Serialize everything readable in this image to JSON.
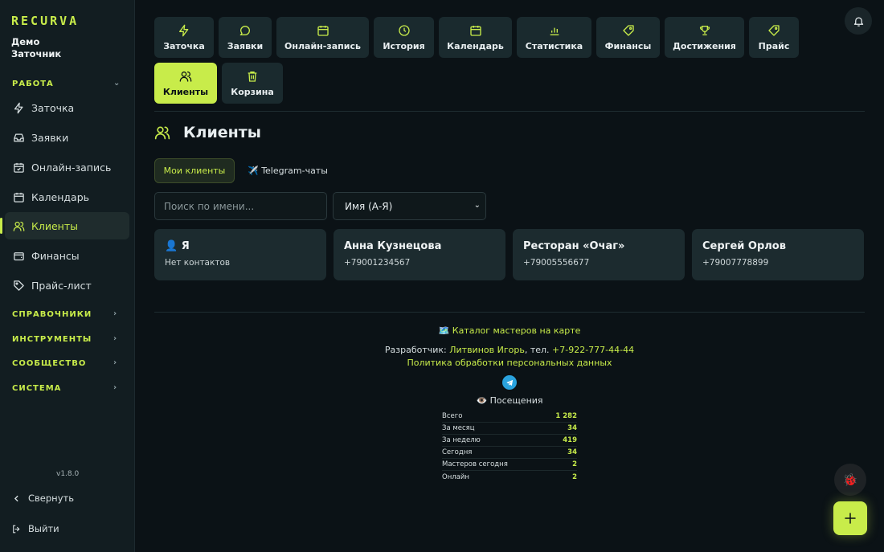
{
  "app": {
    "logo": "RECURVA",
    "user_line1": "Демо",
    "user_line2": "Заточник",
    "version": "v1.8.0"
  },
  "sidebar": {
    "section_work": "РАБОТА",
    "items": [
      {
        "label": "Заточка"
      },
      {
        "label": "Заявки"
      },
      {
        "label": "Онлайн-запись"
      },
      {
        "label": "Календарь"
      },
      {
        "label": "Клиенты",
        "active": true
      },
      {
        "label": "Финансы"
      },
      {
        "label": "Прайс-лист"
      }
    ],
    "sections": [
      "СПРАВОЧНИКИ",
      "ИНСТРУМЕНТЫ",
      "СООБЩЕСТВО",
      "СИСТЕМА"
    ],
    "collapse_label": "Свернуть",
    "logout_label": "Выйти"
  },
  "tiles": [
    {
      "label": "Заточка",
      "icon": "lightning-icon"
    },
    {
      "label": "Заявки",
      "icon": "chat-bubble-icon"
    },
    {
      "label": "Онлайн-запись",
      "icon": "calendar-check-icon"
    },
    {
      "label": "История",
      "icon": "clock-icon"
    },
    {
      "label": "Календарь",
      "icon": "calendar-icon"
    },
    {
      "label": "Статистика",
      "icon": "bar-chart-icon"
    },
    {
      "label": "Финансы",
      "icon": "tag-icon"
    },
    {
      "label": "Достижения",
      "icon": "trophy-icon"
    },
    {
      "label": "Прайс",
      "icon": "price-tag-icon"
    },
    {
      "label": "Клиенты",
      "icon": "users-icon",
      "active": true
    },
    {
      "label": "Корзина",
      "icon": "trash-icon"
    }
  ],
  "page": {
    "title": "Клиенты",
    "tabs": [
      {
        "label": "Мои клиенты",
        "active": true
      },
      {
        "label": "✈️ Telegram-чаты"
      }
    ],
    "search_placeholder": "Поиск по имени...",
    "sort_value": "Имя (А-Я)"
  },
  "clients": [
    {
      "name": "👤 Я",
      "phone": "Нет контактов"
    },
    {
      "name": "Анна Кузнецова",
      "phone": "+79001234567"
    },
    {
      "name": "Ресторан «Очаг»",
      "phone": "+79005556677"
    },
    {
      "name": "Сергей Орлов",
      "phone": "+79007778899"
    }
  ],
  "footer": {
    "catalog_link": "🗺️ Каталог мастеров на карте",
    "dev_prefix": "Разработчик:",
    "dev_name": "Литвинов Игорь",
    "tel_prefix": ", тел.",
    "dev_phone": "+7-922-777-44-44",
    "privacy_link": "Политика обработки персональных данных",
    "visits_title": "👁️ Посещения",
    "stats": [
      {
        "label": "Всего",
        "value": "1 282"
      },
      {
        "label": "За месяц",
        "value": "34"
      },
      {
        "label": "За неделю",
        "value": "419"
      },
      {
        "label": "Сегодня",
        "value": "34"
      },
      {
        "label": "Мастеров сегодня",
        "value": "2"
      },
      {
        "label": "Онлайн",
        "value": "2"
      }
    ]
  },
  "colors": {
    "accent": "#c8ec4a",
    "background": "#0b1216",
    "card": "#1c2b2f"
  }
}
